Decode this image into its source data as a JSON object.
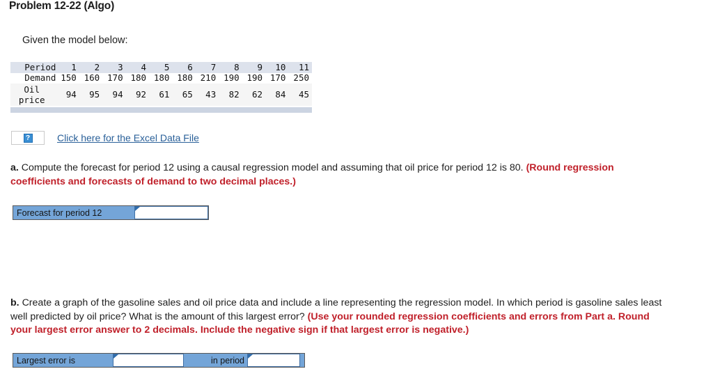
{
  "header": {
    "title": "Problem 12-22 (Algo)"
  },
  "intro": {
    "text": "Given the model below:"
  },
  "table": {
    "rows": [
      {
        "label": "Period",
        "values": [
          "1",
          "2",
          "3",
          "4",
          "5",
          "6",
          "7",
          "8",
          "9",
          "10",
          "11"
        ]
      },
      {
        "label": "Demand",
        "values": [
          "150",
          "160",
          "170",
          "180",
          "180",
          "180",
          "210",
          "190",
          "190",
          "170",
          "250"
        ]
      },
      {
        "label_line1": "Oil",
        "label_line2": "price",
        "values": [
          "94",
          "95",
          "94",
          "92",
          "61",
          "65",
          "43",
          "82",
          "62",
          "84",
          "45"
        ]
      }
    ]
  },
  "excel": {
    "icon_glyph": "?",
    "icon_name": "broken-image-question-icon",
    "link_text": "Click here for the Excel Data File"
  },
  "part_a": {
    "label": "a.",
    "body": "Compute the forecast for period 12 using a causal regression model and assuming that oil price for period 12 is 80.",
    "hint": "(Round regression coefficients and forecasts of demand to two decimal places.)",
    "answer": {
      "label": "Forecast for period 12",
      "value": "",
      "placeholder": ""
    }
  },
  "part_b": {
    "label": "b.",
    "body": "Create a graph of the gasoline sales and oil price data and include a line representing the regression model. In which period is gasoline sales least well predicted by oil price? What is the amount of this largest error?",
    "hint": "(Use your rounded regression coefficients and errors from Part a.  Round your largest error answer to 2 decimals.  Include the negative sign if that largest error is negative.)",
    "answer": {
      "label_left": "Largest error is",
      "value_error": "",
      "label_mid": "in period",
      "value_period": "",
      "placeholder": ""
    }
  },
  "colors": {
    "accent_blue": "#74a5d8",
    "link_blue": "#2a6099",
    "hint_red": "#c0202a",
    "table_header_bg": "#dde2ec",
    "table_alt_bg": "#f5f5f5",
    "table_footer_band": "#ccd4e2"
  }
}
